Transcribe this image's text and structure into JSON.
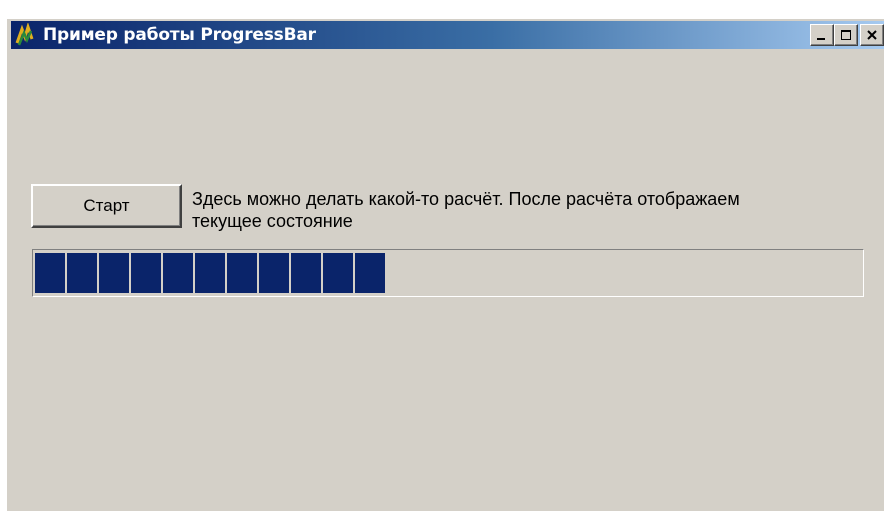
{
  "window": {
    "title": "Пример работы ProgressBar",
    "buttons": {
      "minimize_icon": "minimize-icon",
      "maximize_icon": "maximize-icon",
      "close_icon": "close-icon"
    }
  },
  "main": {
    "start_button_label": "Старт",
    "status_line1": "Здесь можно делать какой-то расчёт. После расчёта отображаем",
    "status_line2": "текущее состояние",
    "progress": {
      "filled_segments": 11,
      "total_segments": 26,
      "fraction": 0.42
    }
  },
  "colors": {
    "titlebar_start": "#0a246a",
    "titlebar_end": "#a6caf0",
    "face": "#d4d0c8",
    "progress_fill": "#0a246a"
  }
}
